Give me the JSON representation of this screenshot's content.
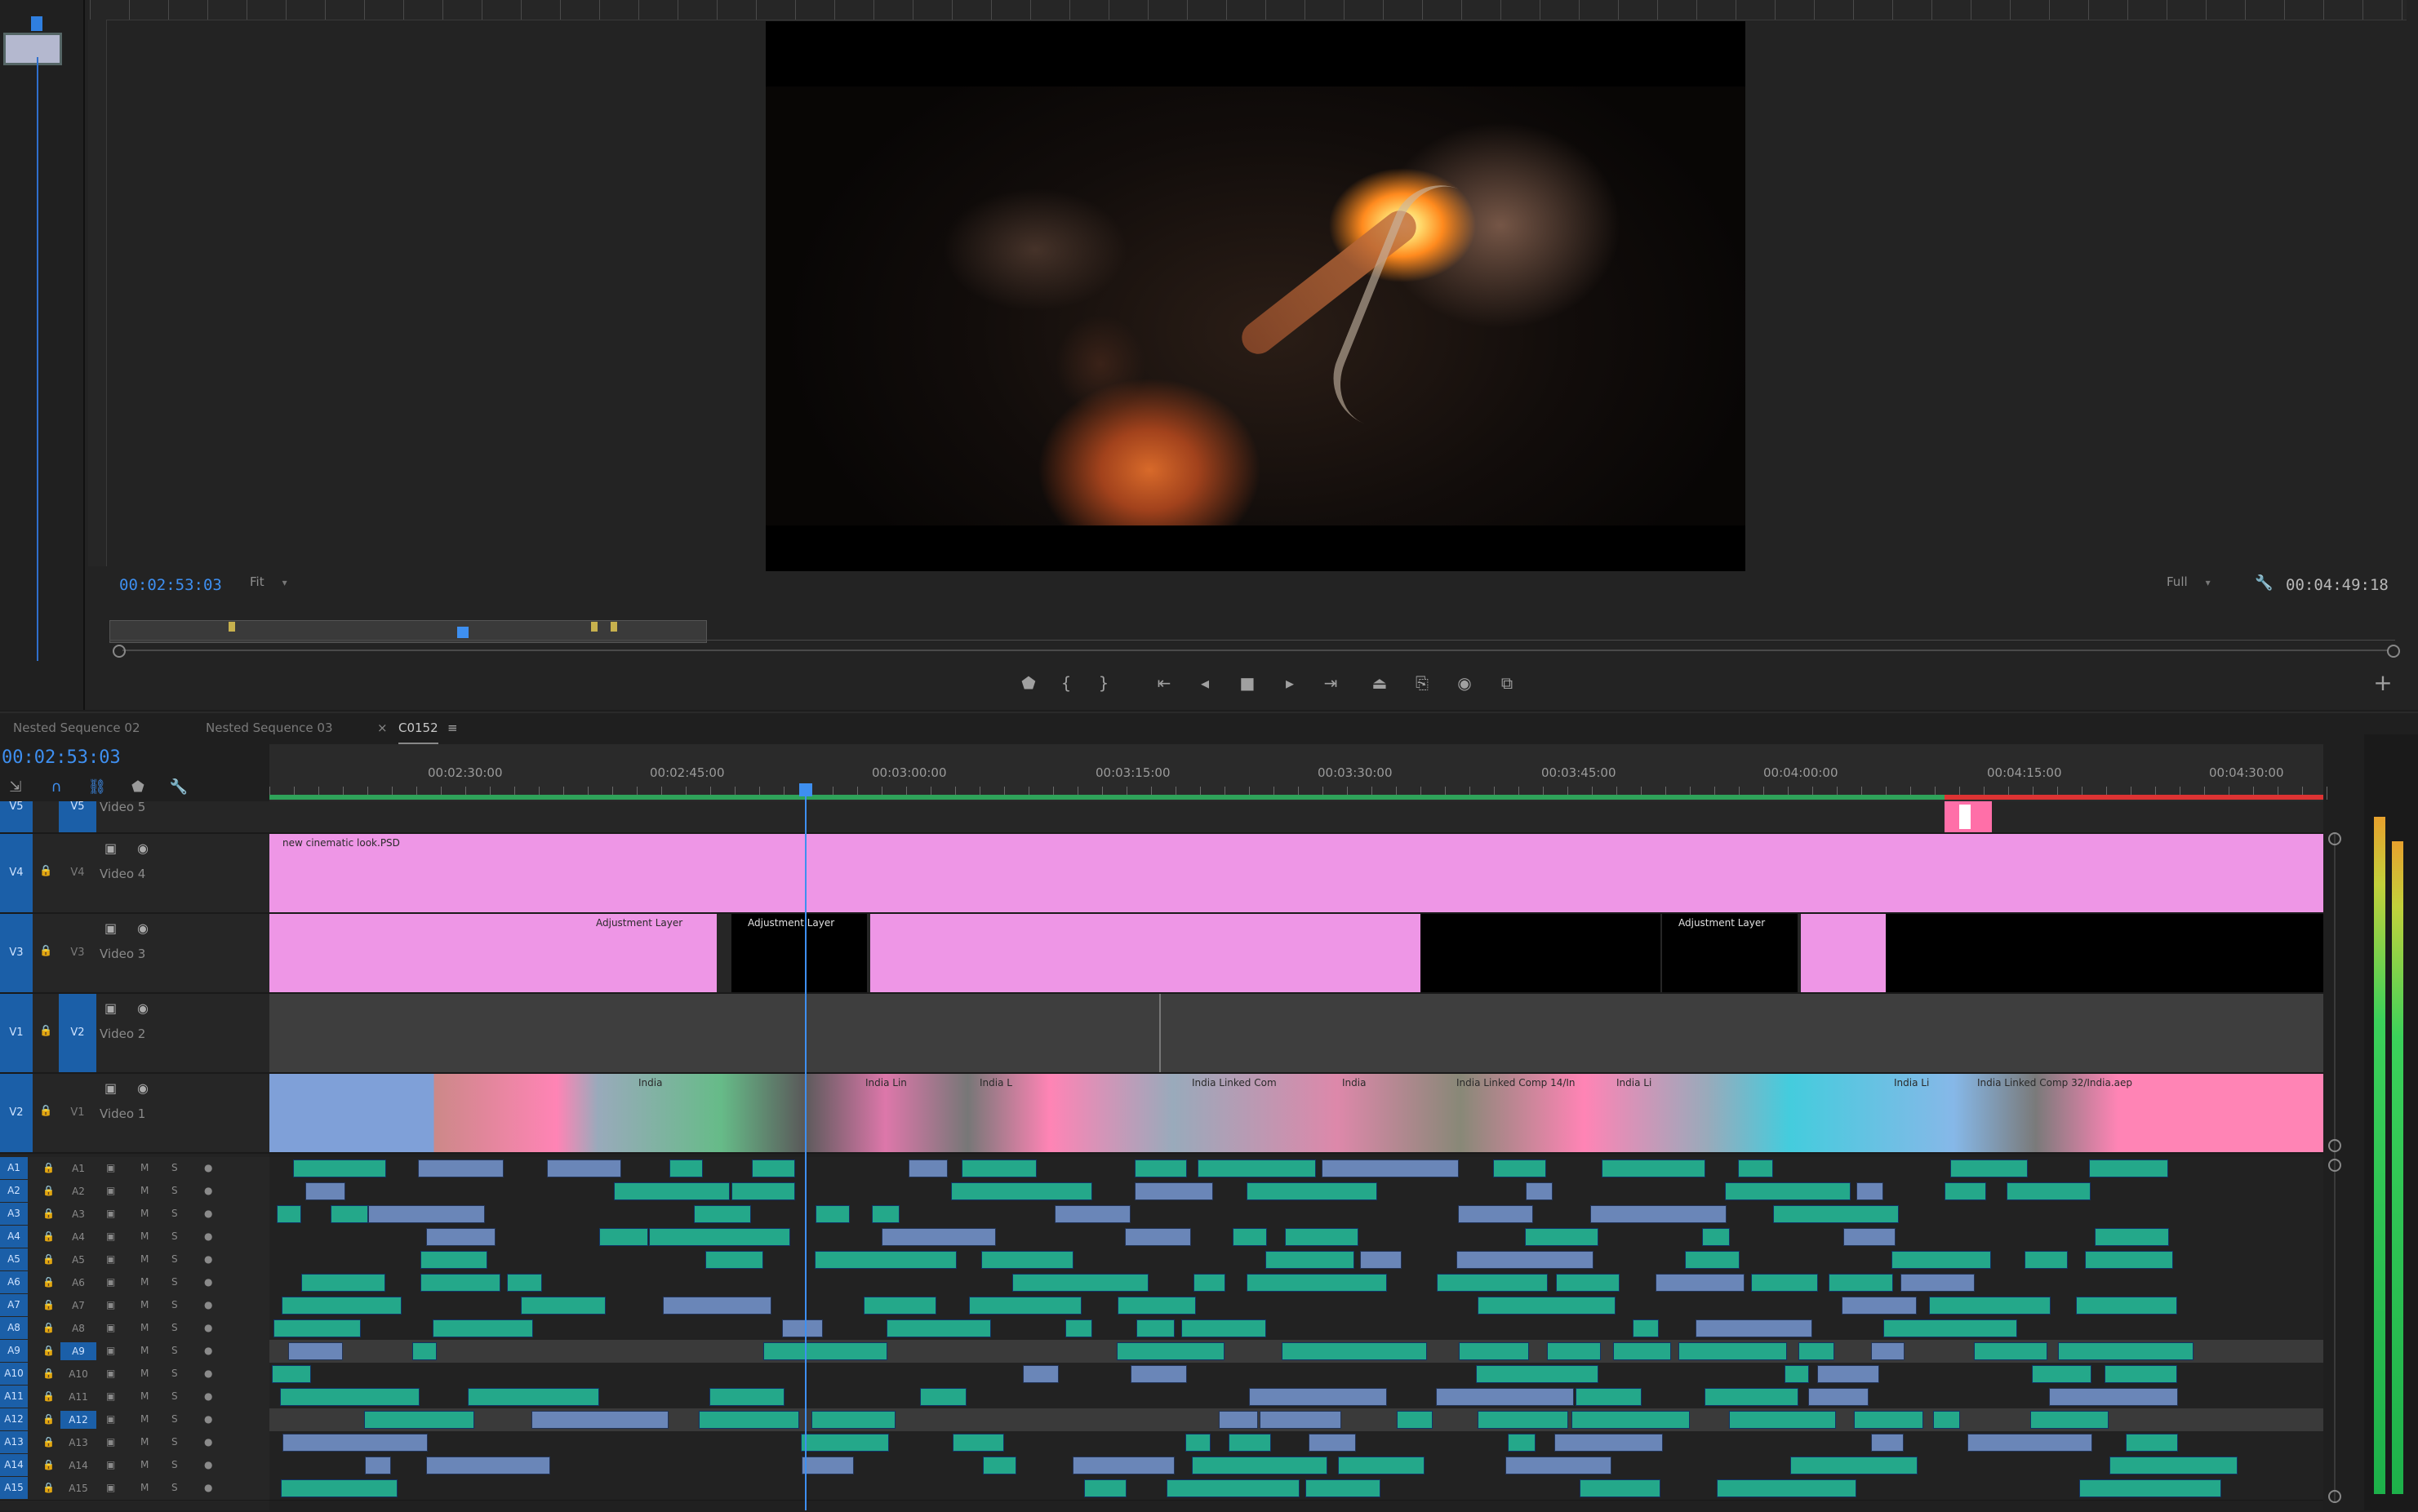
{
  "program_monitor": {
    "current_timecode": "00:02:53:03",
    "zoom_select": "Fit",
    "resolution_select": "Full",
    "duration_timecode": "00:04:49:18",
    "transport": [
      "marker-icon",
      "in-point-icon",
      "out-point-icon",
      "go-to-in-icon",
      "step-back-icon",
      "stop-icon",
      "play-icon",
      "go-to-out-icon",
      "lift-icon",
      "extract-icon",
      "camera-icon",
      "compare-icon"
    ]
  },
  "timeline": {
    "tabs": [
      "Nested Sequence 02",
      "Nested Sequence 03",
      "C0152"
    ],
    "active_tab": "C0152",
    "close_glyph": "×",
    "menu_glyph": "≡",
    "timecode": "00:02:53:03",
    "ruler_labels": [
      "00:02:30:00",
      "00:02:45:00",
      "00:03:00:00",
      "00:03:15:00",
      "00:03:30:00",
      "00:03:45:00",
      "00:04:00:00",
      "00:04:15:00",
      "00:04:30:00"
    ],
    "video_tracks": [
      {
        "src": "V5",
        "tgt": "V5",
        "name": "Video 5"
      },
      {
        "src": "V4",
        "tgt": "V4",
        "name": "Video 4"
      },
      {
        "src": "V3",
        "tgt": "V3",
        "name": "Video 3"
      },
      {
        "src": "V1",
        "tgt": "V2",
        "name": "Video 2"
      },
      {
        "src": "V2",
        "tgt": "V1",
        "name": "Video 1"
      }
    ],
    "audio_tracks": [
      "A1",
      "A2",
      "A3",
      "A4",
      "A5",
      "A6",
      "A7",
      "A8",
      "A9",
      "A10",
      "A11",
      "A12",
      "A13",
      "A14",
      "A15"
    ],
    "audio_src": [
      "A1",
      "A2",
      "A3",
      "A4",
      "A5",
      "A6",
      "A7",
      "A8",
      "A9",
      "A10",
      "A11",
      "A12",
      "A13",
      "A14",
      "A15"
    ],
    "mute_label": "M",
    "solo_label": "S",
    "clips": {
      "v4": "new cinematic look.PSD",
      "adj1": "Adjustment Layer",
      "adj2": "Adjustment Layer",
      "adj3": "Adjustment Layer",
      "india1": "India",
      "india2": "India Lin",
      "india3": "India L",
      "india4": "India Linked Com",
      "india5": "India",
      "india6": "India Linked Comp 14/In",
      "india7": "India Li",
      "india8": "India Li",
      "india9": "India Linked Comp 32/India.aep"
    }
  },
  "colors": {
    "accent_blue": "#3e8ff0",
    "video_clip_pink": "#ee96e6",
    "audio_clip_green": "#24a88a",
    "audio_clip_blue": "#6a86b8",
    "work_area_green": "#2fa35a"
  }
}
